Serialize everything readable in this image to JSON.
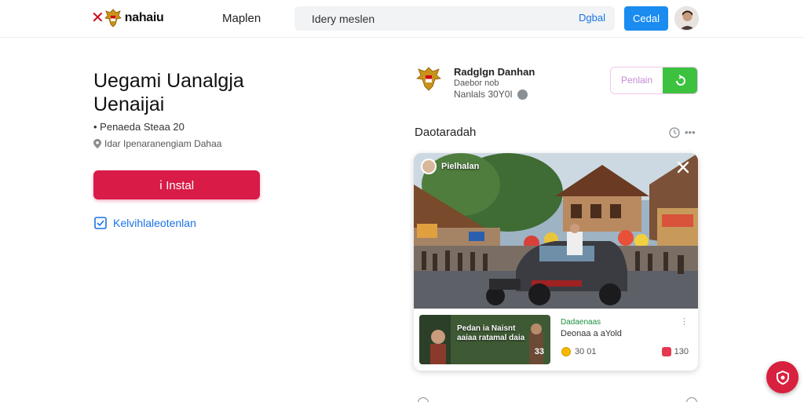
{
  "header": {
    "brand": "nahaiu",
    "nav_label": "Maplen",
    "search": {
      "value": "Idery meslen",
      "button": "Dgbal"
    },
    "cancel_label": "Cedal"
  },
  "main": {
    "title": "Uegami Uanalgja Uenaijai",
    "meta_stats": "• Penaeda Steaa 20",
    "meta_location": "Idar Ipenaranengiam Dahaa",
    "install_label": "Instal",
    "extra_link": "Kelvihlaleotenlan"
  },
  "publisher": {
    "name": "Radglgn Danhan",
    "subtitle": "Daebor nob",
    "meta": "Nanlals 30Y0I",
    "follow_label": "Penlain"
  },
  "section": {
    "title": "Daotaradah",
    "more": "•••"
  },
  "card": {
    "author": "Pielhalan",
    "thumb_text": "Pedan ia Naisnt aaiaa ratamal daia",
    "thumb_count": "33",
    "item_title": "Dadaenaas",
    "item_subtitle": "Deonaa a aYold",
    "item_more": "⋮",
    "coins": "30 01",
    "likes": "130"
  },
  "colors": {
    "accent_blue": "#1a8cf0",
    "install_red": "#d81b47",
    "follow_green": "#3cc23f",
    "fab_red": "#d8203f"
  }
}
